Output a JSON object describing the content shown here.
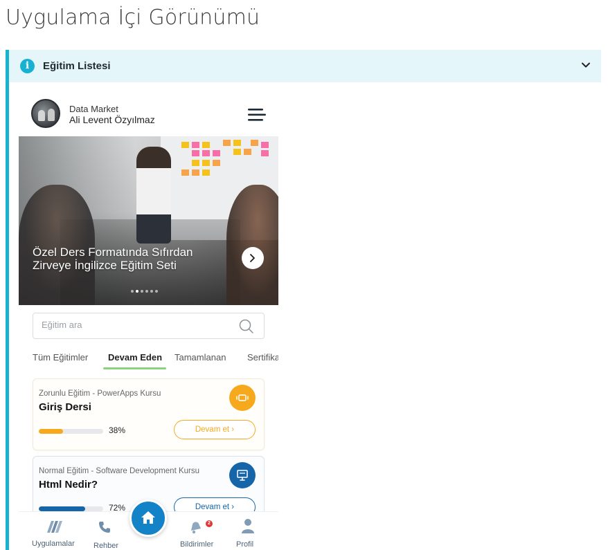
{
  "page": {
    "title": "Uygulama İçi Görünümü"
  },
  "panel": {
    "title": "Eğitim Listesi",
    "icon": "info-icon",
    "toggle_icon": "chevron-down-icon",
    "accent": "#17b3cf",
    "header_bg": "#e5f6fa"
  },
  "app": {
    "company": "Data Market",
    "user": "Ali Levent Özyılmaz",
    "hero": {
      "title": "Özel Ders Formatında Sıfırdan Zirveye İngilizce Eğitim Seti",
      "slide_count": 6,
      "active_slide": 2
    },
    "search": {
      "placeholder": "Eğitim ara",
      "value": ""
    },
    "tabs": [
      "Tüm Eğitimler",
      "Devam Eden",
      "Tamamlanan",
      "Sertifika"
    ],
    "active_tab": 1,
    "courses": [
      {
        "category": "Zorunlu Eğitim - PowerApps Kursu",
        "title": "Giriş Dersi",
        "progress": 0.38,
        "progress_label": "38%",
        "button": "Devam et",
        "icon": "video-icon",
        "color": "#f7a91e"
      },
      {
        "category": "Normal Eğitim - Software Development Kursu",
        "title": "Html Nedir?",
        "progress": 0.72,
        "progress_label": "72%",
        "button": "Devam et",
        "icon": "presentation-icon",
        "color": "#1565a8"
      }
    ],
    "nav": [
      {
        "label": "Uygulamalar",
        "icon": "apps-icon"
      },
      {
        "label": "Rehber",
        "icon": "phone-icon"
      },
      {
        "label": "Ana Sayfa",
        "icon": "home-icon"
      },
      {
        "label": "Bildirimler",
        "icon": "bell-icon",
        "badge": "2"
      },
      {
        "label": "Profil",
        "icon": "user-icon"
      }
    ]
  }
}
